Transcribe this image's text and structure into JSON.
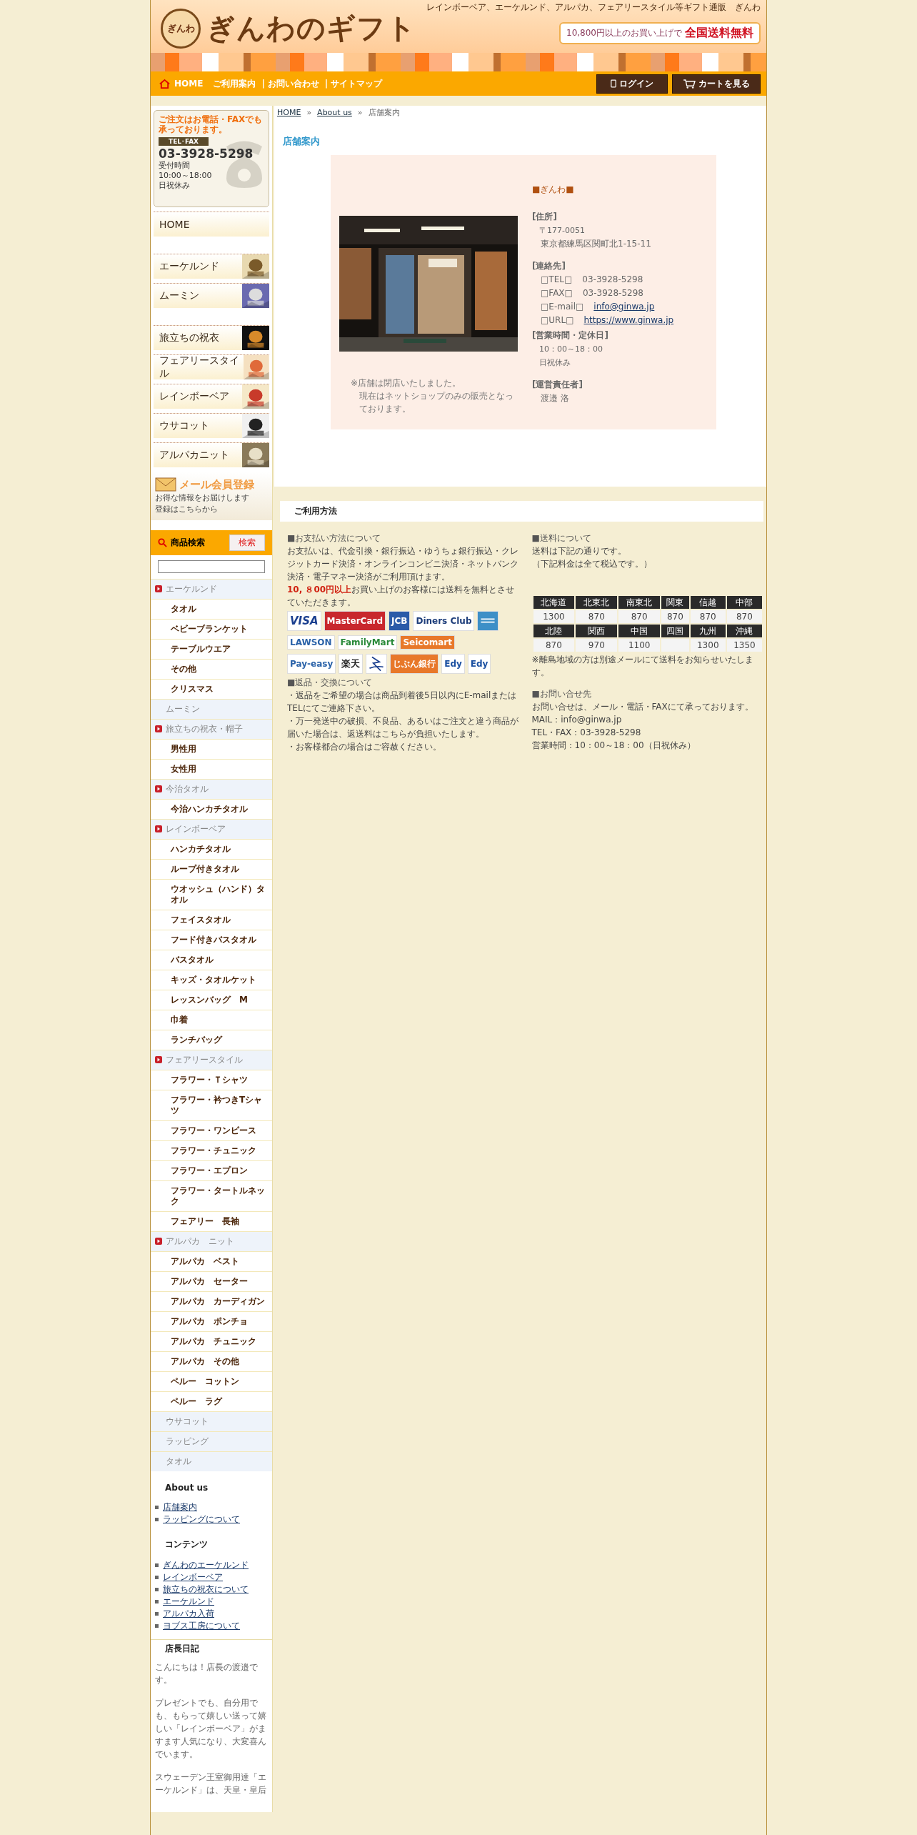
{
  "header": {
    "logo_badge": "ぎんわ",
    "title": "ぎんわのギフト",
    "tagline": "レインボーベア、エーケルンド、アルパカ、フェアリースタイル等ギフト通販　ぎんわ",
    "promo": {
      "text": "10,800円以上のお買い上げで",
      "highlight": "全国送料無料"
    }
  },
  "nav": {
    "home": "HOME",
    "separator": "|",
    "links": [
      "ご利用案内",
      "お問い合わせ",
      "サイトマップ"
    ],
    "buttons": [
      {
        "label": "ログイン",
        "kind": "login"
      },
      {
        "label": "カートを見る",
        "kind": "cart"
      }
    ]
  },
  "order_box": {
    "headline": "ご注文はお電話・FAXでも承っております。",
    "tag": "TEL･FAX",
    "phone": "03-3928-5298",
    "lines": [
      "受付時間",
      "10:00～18:00",
      "日祝休み"
    ]
  },
  "side_menu": [
    {
      "label": "HOME",
      "thumb": false
    },
    {
      "label": "エーケルンド",
      "thumb": true
    },
    {
      "label": "ムーミン",
      "thumb": true
    },
    {
      "label": "旅立ちの祝衣",
      "thumb": true
    },
    {
      "label": "フェアリースタイル",
      "thumb": true
    },
    {
      "label": "レインボーベア",
      "thumb": true
    },
    {
      "label": "ウサコット",
      "thumb": true
    },
    {
      "label": "アルパカニット",
      "thumb": true
    }
  ],
  "mail_banner": {
    "title": "メール会員登録",
    "lines": [
      "お得な情報をお届けします",
      "登録はこちらから"
    ]
  },
  "search": {
    "title": "商品検索",
    "button": "検索"
  },
  "categories": [
    {
      "label": "エーケルンド",
      "children": [
        "タオル",
        "ベビーブランケット",
        "テーブルウエア",
        "その他",
        "クリスマス"
      ]
    },
    {
      "label": "ムーミン"
    },
    {
      "label": "旅立ちの祝衣・帽子",
      "children": [
        "男性用",
        "女性用"
      ]
    },
    {
      "label": "今治タオル",
      "children": [
        "今治ハンカチタオル"
      ]
    },
    {
      "label": "レインボーベア",
      "children": [
        "ハンカチタオル",
        "ループ付きタオル",
        "ウオッシュ（ハンド）タオル",
        "フェイスタオル",
        "フード付きバスタオル",
        "バスタオル",
        "キッズ・タオルケット",
        "レッスンバッグ　M",
        "巾着",
        "ランチバッグ"
      ]
    },
    {
      "label": "フェアリースタイル",
      "children": [
        "フラワー・Ｔシャツ",
        "フラワー・衿つきTシャツ",
        "フラワー・ワンピース",
        "フラワー・チュニック",
        "フラワー・エプロン",
        "フラワー・タートルネック",
        "フェアリー　長袖"
      ]
    },
    {
      "label": "アルパカ　ニット",
      "children": [
        "アルパカ　ベスト",
        "アルパカ　セーター",
        "アルパカ　カーディガン",
        "アルパカ　ポンチョ",
        "アルパカ　チュニック",
        "アルパカ　その他",
        "ペルー　コットン",
        "ペルー　ラグ"
      ]
    },
    {
      "label": "ウサコット"
    },
    {
      "label": "ラッピング"
    },
    {
      "label": "タオル"
    }
  ],
  "link_groups": [
    {
      "title": "About us",
      "links": [
        "店舗案内",
        "ラッピングについて"
      ]
    },
    {
      "title": "コンテンツ",
      "links": [
        "ぎんわのエーケルンド",
        "レインボーベア",
        "旅立ちの祝衣について",
        "エーケルンド",
        "アルパカ入荷",
        "ヨブス工房について"
      ]
    }
  ],
  "diary": {
    "title": "店長日記",
    "paragraphs": [
      "こんにちは！店長の渡邉です。",
      "プレゼントでも、自分用でも、もらって嬉しい送って嬉しい「レインボーベア」がますます人気になり、大変喜んでいます。",
      "スウェーデン王室御用達「エーケルンド」は、天皇・皇后"
    ]
  },
  "breadcrumb": [
    {
      "label": "HOME",
      "link": true
    },
    {
      "label": "About us",
      "link": true
    },
    {
      "label": "店舗案内",
      "link": false
    }
  ],
  "breadcrumb_separator": "»",
  "page_title": "店舗案内",
  "shop": {
    "note": [
      "※店舗は閉店いたしました。",
      "現在はネットショップのみの販売となっております。"
    ],
    "name": "■ぎんわ■",
    "sections": [
      {
        "heading": "[住所]",
        "rows": [
          {
            "kind": "small",
            "text": "〒177-0051"
          },
          {
            "kind": "text",
            "text": "東京都練馬区関町北1-15-11"
          }
        ]
      },
      {
        "heading": "[連絡先]",
        "rows": [
          {
            "kind": "pair",
            "label": "□TEL□",
            "text": "03-3928-5298"
          },
          {
            "kind": "pair",
            "label": "□FAX□",
            "text": "03-3928-5298"
          },
          {
            "kind": "link",
            "label": "□E-mail□",
            "text": "info@ginwa.jp"
          },
          {
            "kind": "link",
            "label": "□URL□",
            "text": "https://www.ginwa.jp"
          }
        ]
      },
      {
        "heading": "[営業時間・定休日]",
        "rows": [
          {
            "kind": "small",
            "text": "10：00～18：00"
          },
          {
            "kind": "small",
            "text": "日祝休み"
          }
        ]
      },
      {
        "heading": "[運営責任者]",
        "rows": [
          {
            "kind": "text",
            "text": "渡邉 洛"
          }
        ]
      }
    ]
  },
  "usage": {
    "title": "ご利用方法",
    "payment": {
      "heading": "■お支払い方法について",
      "text": "お支払いは、代金引換・銀行振込・ゆうちょ銀行振込・クレジットカード決済・オンラインコンビニ決済・ネットバンク決済・電子マネー決済がご利用頂けます。",
      "note": "**10, ８00円以上**お買い上げのお客様には送料を無料とさせていただきます。",
      "logo_rows": [
        [
          {
            "label": "VISA",
            "kind": "visa"
          },
          {
            "label": "MasterCard",
            "kind": "master"
          },
          {
            "label": "JCB",
            "kind": "jcb"
          },
          {
            "label": "Diners Club",
            "kind": "diners"
          },
          {
            "kind": "amex"
          }
        ],
        [
          {
            "label": "LAWSON",
            "kind": "lawson"
          },
          {
            "label": "FamilyMart",
            "kind": "family"
          },
          {
            "label": "Seicomart",
            "kind": "seico"
          }
        ],
        [
          {
            "label": "Pay-easy",
            "kind": "payeasy"
          },
          {
            "label": "楽天",
            "kind": "rakuten"
          },
          {
            "kind": "jnb"
          },
          {
            "label": "じぶん銀行",
            "kind": "jibun"
          },
          {
            "label": "Edy",
            "kind": "edy"
          },
          {
            "label": "Edy",
            "kind": "edy"
          }
        ]
      ]
    },
    "returns": {
      "heading": "■返品・交換について",
      "lines": [
        "・返品をご希望の場合は商品到着後5日以内にE-mailまたはTELにてご連絡下さい。",
        "・万一発送中の破損、不良品、あるいはご注文と違う商品が届いた場合は、返送料はこちらが負担いたします。",
        "・お客様都合の場合はご容赦ください。"
      ]
    },
    "shipping": {
      "heading": "■送料について",
      "text": "送料は下記の通りです。",
      "small": "（下記料金は全て税込です。）",
      "rows": [
        [
          {
            "region": "北海道",
            "price": "1300"
          },
          {
            "region": "北東北",
            "price": "870"
          },
          {
            "region": "南東北",
            "price": "870"
          },
          {
            "region": "関東",
            "price": "870"
          },
          {
            "region": "信越",
            "price": "870"
          },
          {
            "region": "中部",
            "price": "870"
          }
        ],
        [
          {
            "region": "北陸",
            "price": "870"
          },
          {
            "region": "関西",
            "price": "970"
          },
          {
            "region": "中国",
            "price": "1100"
          },
          {
            "region": "四国"
          },
          {
            "region": "九州",
            "price": "1300"
          },
          {
            "region": "沖縄",
            "price": "1350"
          }
        ]
      ],
      "note": "※離島地域の方は別途メールにて送料をお知らせいたします。"
    },
    "contact": {
      "heading": "■お問い合せ先",
      "lines": [
        "お問い合せは、メール・電話・FAXにて承っております。",
        "MAIL：info@ginwa.jp",
        "TEL・FAX：03-3928-5298",
        "営業時間：10：00～18：00（日祝休み）"
      ]
    }
  }
}
